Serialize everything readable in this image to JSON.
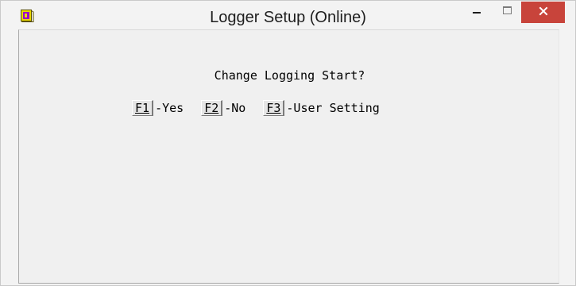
{
  "window": {
    "title": "Logger Setup (Online)",
    "close_glyph": "✕",
    "accent_close": "#c8443b"
  },
  "dialog": {
    "prompt": "Change Logging Start?",
    "options": [
      {
        "key": "F1",
        "label": "-Yes"
      },
      {
        "key": "F2",
        "label": "-No"
      },
      {
        "key": "F3",
        "label": "-User Setting"
      }
    ]
  },
  "icons": {
    "app": "logger-app-icon",
    "minimize": "minimize-icon",
    "maximize": "maximize-icon",
    "close": "close-icon"
  }
}
